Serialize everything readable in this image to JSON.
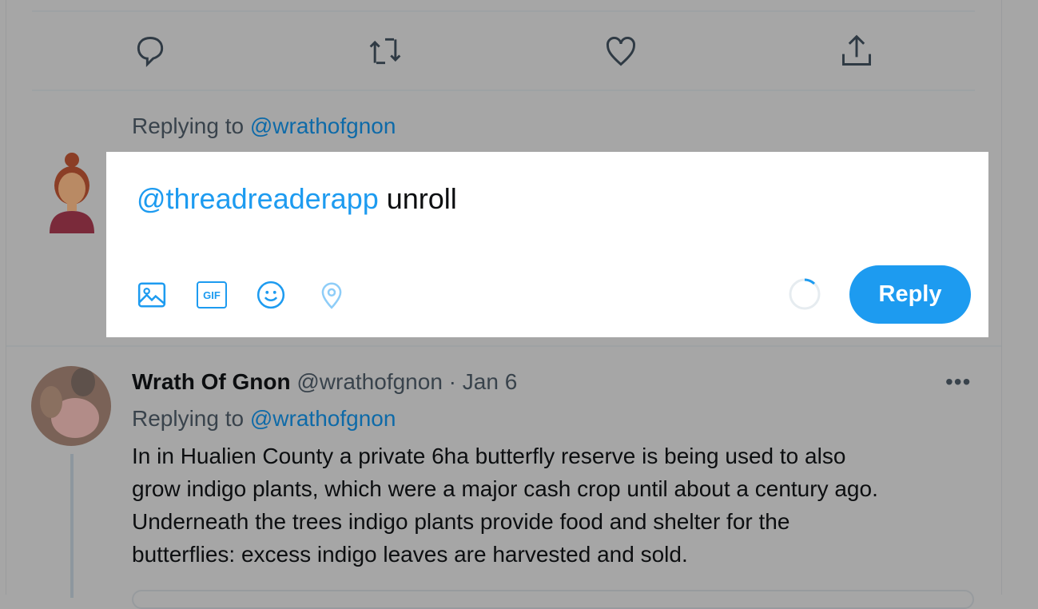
{
  "actions": [
    "reply-icon",
    "retweet-icon",
    "like-icon",
    "share-icon"
  ],
  "composer": {
    "replying_label": "Replying to",
    "replying_handle": "@wrathofgnon",
    "mention": "@threadreaderapp",
    "text": " unroll",
    "reply_button": "Reply",
    "tools": [
      "image-icon",
      "gif-icon",
      "emoji-icon",
      "location-icon"
    ],
    "gif_label": "GIF",
    "accent": "#1d9bf0"
  },
  "tweet": {
    "name": "Wrath Of Gnon",
    "handle": "@wrathofgnon",
    "sep": " · ",
    "date": "Jan 6",
    "replying_label": "Replying to",
    "replying_handle": "@wrathofgnon",
    "lines": [
      "In in Hualien County a private 6ha butterfly reserve is being used to also",
      "grow indigo plants, which were a major cash crop until about a century ago.",
      "Underneath the trees indigo plants provide food and shelter for the",
      "butterflies: excess indigo leaves are harvested and sold."
    ]
  }
}
